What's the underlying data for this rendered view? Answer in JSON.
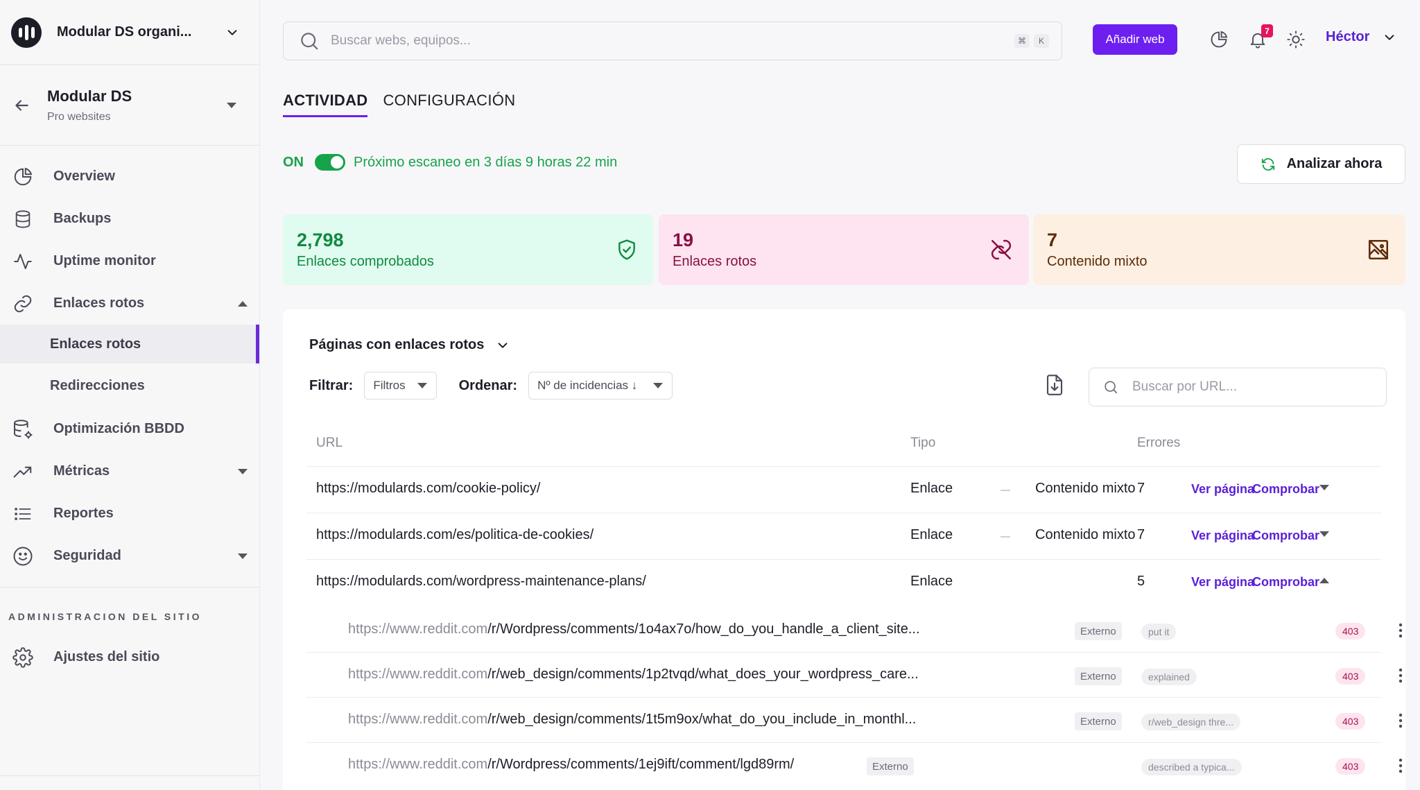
{
  "org": {
    "name": "Modular DS organi..."
  },
  "site": {
    "title": "Modular DS",
    "subtitle": "Pro websites"
  },
  "nav": {
    "overview": "Overview",
    "backups": "Backups",
    "uptime": "Uptime monitor",
    "broken_links": "Enlaces rotos",
    "broken_links_sub": "Enlaces rotos",
    "redirects": "Redirecciones",
    "db_opt": "Optimización BBDD",
    "metrics": "Métricas",
    "reports": "Reportes",
    "security": "Seguridad"
  },
  "admin": {
    "heading": "ADMINISTRACION DEL SITIO",
    "settings": "Ajustes del sitio"
  },
  "search": {
    "placeholder": "Buscar webs, equipos...",
    "kbd_cmd": "⌘",
    "kbd_k": "K"
  },
  "topbar": {
    "add_web": "Añadir web",
    "notifications": "7",
    "user": "Héctor"
  },
  "tabs": {
    "activity": "ACTIVIDAD",
    "config": "CONFIGURACIÓN"
  },
  "scan": {
    "status": "ON",
    "next": "Próximo escaneo en 3 días 9 horas 22 min",
    "analyze": "Analizar ahora"
  },
  "stats": {
    "checked": {
      "value": "2,798",
      "label": "Enlaces comprobados"
    },
    "broken": {
      "value": "19",
      "label": "Enlaces rotos"
    },
    "mixed": {
      "value": "7",
      "label": "Contenido mixto"
    }
  },
  "panel": {
    "title": "Páginas con enlaces rotos",
    "filter_label": "Filtrar:",
    "filter_value": "Filtros",
    "sort_label": "Ordenar:",
    "sort_value": "Nº de incidencias ↓",
    "url_search_placeholder": "Buscar por URL..."
  },
  "table": {
    "headers": {
      "url": "URL",
      "type": "Tipo",
      "errors": "Errores"
    },
    "view_label": "Ver página",
    "check_label": "Comprobar",
    "rows": [
      {
        "url": "https://modulards.com/cookie-policy/",
        "type": "Enlace",
        "mixed": "Contenido mixto",
        "errors": "7"
      },
      {
        "url": "https://modulards.com/es/politica-de-cookies/",
        "type": "Enlace",
        "mixed": "Contenido mixto",
        "errors": "7"
      },
      {
        "url": "https://modulards.com/wordpress-maintenance-plans/",
        "type": "Enlace",
        "mixed": "",
        "errors": "5"
      }
    ],
    "sub_rows": [
      {
        "domain": "https://www.reddit.com",
        "path": "/r/Wordpress/comments/1o4ax7o/how_do_you_handle_a_client_site...",
        "tag": "Externo",
        "note": "put it",
        "code": "403"
      },
      {
        "domain": "https://www.reddit.com",
        "path": "/r/web_design/comments/1p2tvqd/what_does_your_wordpress_care...",
        "tag": "Externo",
        "note": "explained",
        "code": "403"
      },
      {
        "domain": "https://www.reddit.com",
        "path": "/r/web_design/comments/1t5m9ox/what_do_you_include_in_monthl...",
        "tag": "Externo",
        "note": "r/web_design thre...",
        "code": "403"
      },
      {
        "domain": "https://www.reddit.com",
        "path": "/r/Wordpress/comments/1ej9ift/comment/lgd89rm/",
        "tag": "Externo",
        "note": "described a typica...",
        "code": "403"
      }
    ]
  },
  "colors": {
    "accent": "#6d1ff0",
    "success": "#17a34a",
    "danger": "#a5134f"
  }
}
